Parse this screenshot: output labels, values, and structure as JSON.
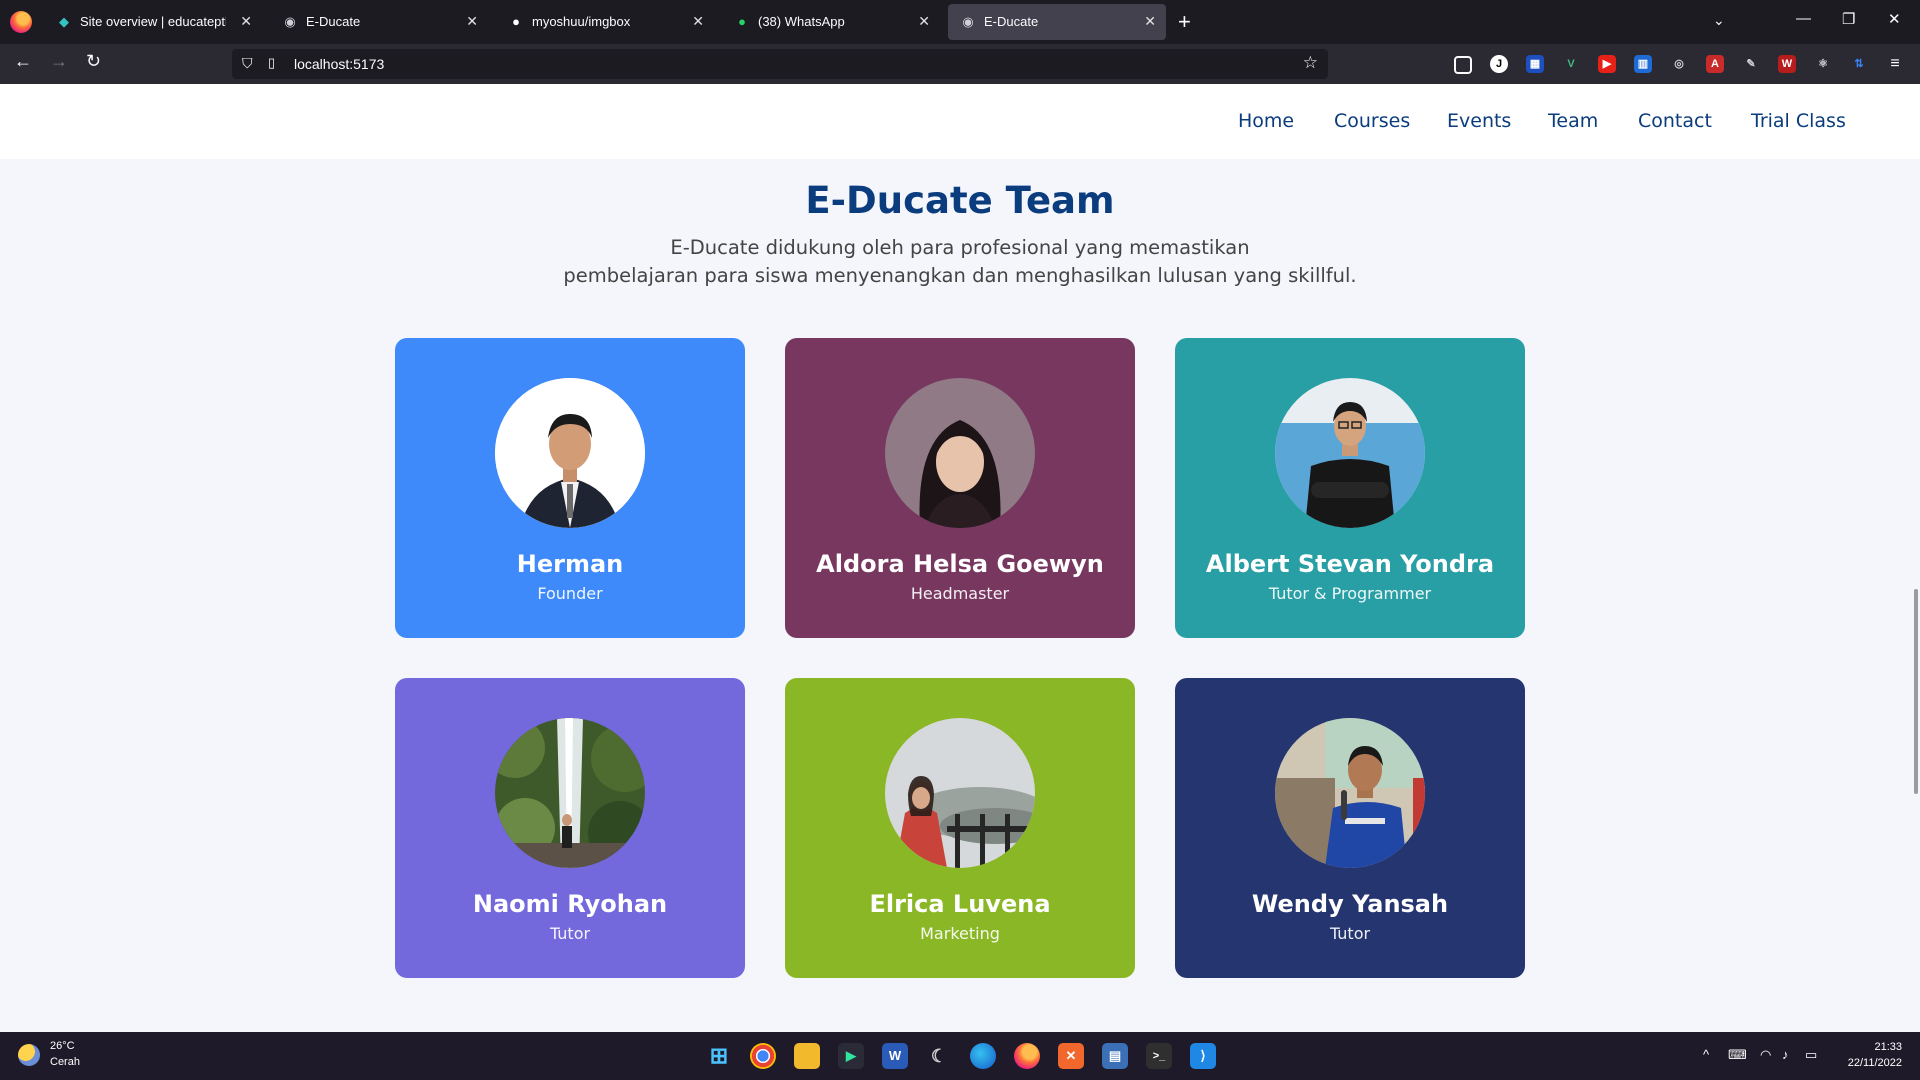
{
  "browser": {
    "tabs": [
      {
        "title": "Site overview | educateptk",
        "icon": "netlify-icon",
        "active": false
      },
      {
        "title": "E-Ducate",
        "icon": "globe-icon",
        "active": false
      },
      {
        "title": "myoshuu/imgbox",
        "icon": "github-icon",
        "active": false
      },
      {
        "title": "(38) WhatsApp",
        "icon": "whatsapp-icon",
        "active": false
      },
      {
        "title": "E-Ducate",
        "icon": "globe-icon",
        "active": true
      }
    ],
    "url": "localhost:5173"
  },
  "site": {
    "nav": [
      "Home",
      "Courses",
      "Events",
      "Team",
      "Contact",
      "Trial Class"
    ],
    "section": {
      "title": "E-Ducate Team",
      "description_line1": "E-Ducate didukung oleh para profesional yang memastikan",
      "description_line2": "pembelajaran para siswa menyenangkan dan menghasilkan lulusan yang skillful."
    },
    "team": [
      {
        "name": "Herman",
        "role": "Founder",
        "color": "#3e8afa"
      },
      {
        "name": "Aldora Helsa Goewyn",
        "role": "Headmaster",
        "color": "#77375f"
      },
      {
        "name": "Albert Stevan Yondra",
        "role": "Tutor & Programmer",
        "color": "#289ea5"
      },
      {
        "name": "Naomi Ryohan",
        "role": "Tutor",
        "color": "#7469dc"
      },
      {
        "name": "Elrica Luvena",
        "role": "Marketing",
        "color": "#8ab725"
      },
      {
        "name": "Wendy Yansah",
        "role": "Tutor",
        "color": "#253570"
      }
    ]
  },
  "taskbar": {
    "weather_temp": "26°C",
    "weather_desc": "Cerah",
    "time": "21:33",
    "date": "22/11/2022"
  }
}
